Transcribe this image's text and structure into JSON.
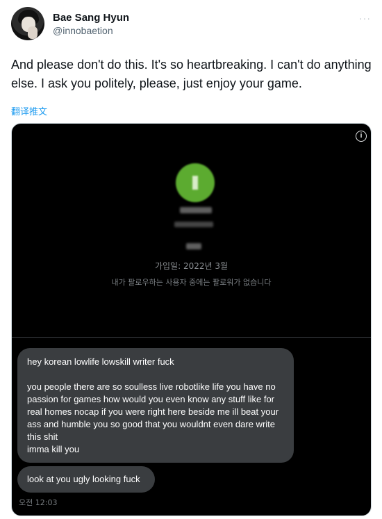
{
  "author": {
    "name": "Bae Sang Hyun",
    "handle": "@innobaetion"
  },
  "more_icon": "more-horizontal-icon",
  "tweet": {
    "text": "And please don't do this. It's so heartbreaking. I can't do anything else. I ask you politely, please, just enjoy your game.",
    "translate_label": "翻译推文"
  },
  "media": {
    "info_icon": "info-icon",
    "profile": {
      "joined": "가입일: 2022년 3월",
      "no_mutual_followers": "내가 팔로우하는 사용자 중에는 팔로워가 없습니다"
    },
    "messages": [
      {
        "lines": [
          "hey korean lowlife lowskill writer fuck",
          "",
          "you people there are so soulless live robotlike life you have no passion for games how would you even know any stuff like for real homes nocap if you were right here beside me ill beat your ass and humble you so good that you wouldnt even dare write this shit",
          "imma kill you"
        ]
      },
      {
        "lines": [
          "look at you ugly looking fuck"
        ]
      }
    ],
    "timestamp": "오전 12:03"
  },
  "colors": {
    "link": "#1d9bf0",
    "bubble": "#3a3d40",
    "profile_green": "#5cab30",
    "secondary_text": "#536471"
  }
}
